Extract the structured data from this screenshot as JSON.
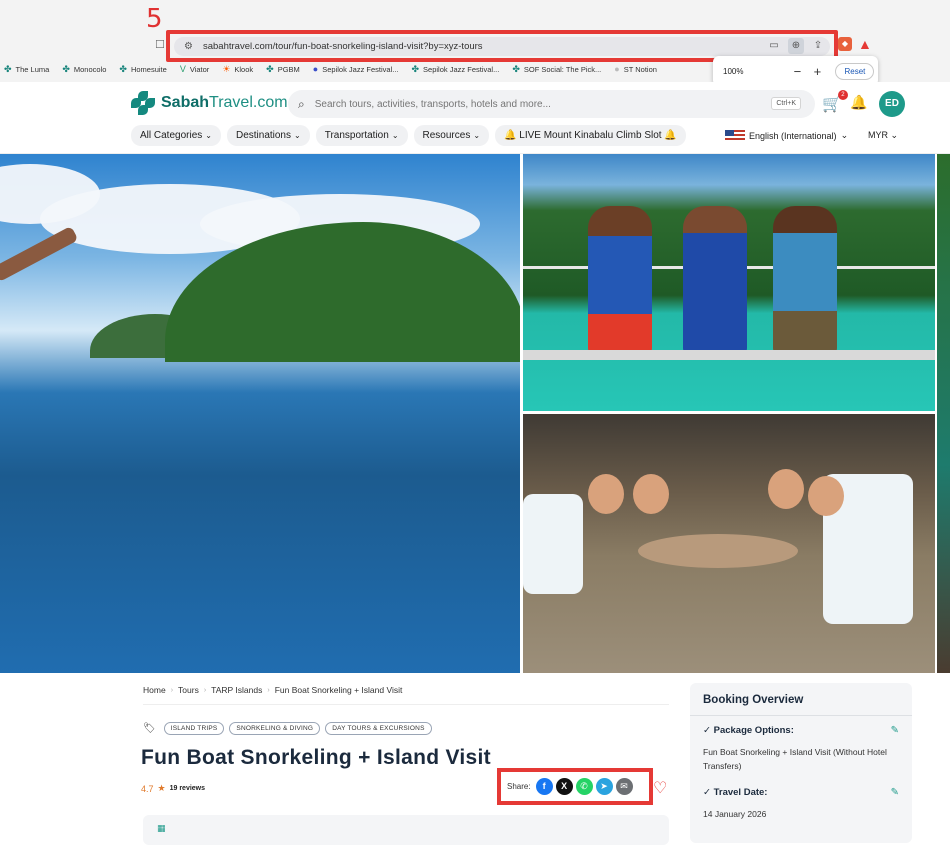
{
  "annotation": {
    "step": "5"
  },
  "browser": {
    "url": "sabahtravel.com/tour/fun-boat-snorkeling-island-visit?by=xyz-tours",
    "bookmarks": [
      "The Luma",
      "Monocolo",
      "Homesuite",
      "Viator",
      "Klook",
      "PGBM",
      "Sepilok Jazz Festival...",
      "Sepilok Jazz Festival...",
      "SOF Social: The Pick...",
      "ST Notion"
    ],
    "zoom": {
      "level": "100%",
      "minus": "−",
      "plus": "+",
      "reset_label": "Reset"
    }
  },
  "header": {
    "logo_bold": "Sabah",
    "logo_rest": "Travel.com",
    "search_placeholder": "Search tours, activities, transports, hotels and more...",
    "search_shortcut": "Ctrl+K",
    "cart_count": "2",
    "avatar_initials": "ED",
    "nav": [
      "All Categories",
      "Destinations",
      "Transportation",
      "Resources"
    ],
    "live_label": "LIVE Mount Kinabalu Climb Slot",
    "language": "English (International)",
    "currency": "MYR"
  },
  "breadcrumb": [
    "Home",
    "Tours",
    "TARP Islands",
    "Fun Boat Snorkeling + Island Visit"
  ],
  "tags": [
    "ISLAND TRIPS",
    "SNORKELING & DIVING",
    "DAY TOURS & EXCURSIONS"
  ],
  "tour": {
    "title": "Fun Boat Snorkeling + Island Visit",
    "rating": "4.7",
    "reviews": "19 reviews",
    "share_label": "Share:"
  },
  "share_icons": [
    {
      "name": "facebook-icon",
      "glyph": "f",
      "color": "#1877f2"
    },
    {
      "name": "x-icon",
      "glyph": "X",
      "color": "#111111"
    },
    {
      "name": "whatsapp-icon",
      "glyph": "✆",
      "color": "#25d366"
    },
    {
      "name": "telegram-icon",
      "glyph": "➤",
      "color": "#2aa3df"
    },
    {
      "name": "email-icon",
      "glyph": "✉",
      "color": "#6c6f73"
    }
  ],
  "booking": {
    "heading": "Booking Overview",
    "package_label": "Package Options:",
    "package_value": "Fun Boat Snorkeling + Island Visit (Without Hotel Transfers)",
    "date_label": "Travel Date:",
    "date_value": "14 January 2026"
  }
}
